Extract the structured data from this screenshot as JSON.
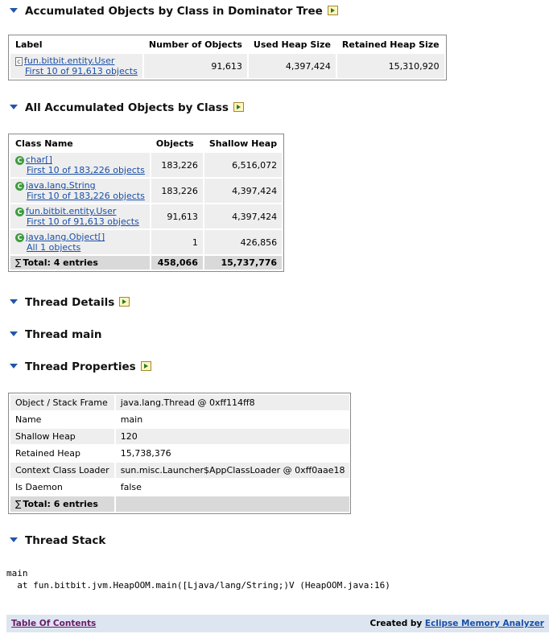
{
  "sections": {
    "accumulated_by_class_dominator": "Accumulated Objects by Class in Dominator Tree",
    "all_accumulated_by_class": "All Accumulated Objects by Class",
    "thread_details": "Thread Details",
    "thread_main": "Thread main",
    "thread_properties": "Thread Properties",
    "thread_stack": "Thread Stack"
  },
  "dominator_table": {
    "headers": [
      "Label",
      "Number of Objects",
      "Used Heap Size",
      "Retained Heap Size"
    ],
    "row": {
      "label": "fun.bitbit.entity.User",
      "sub": "First 10 of 91,613 objects",
      "number_of_objects": "91,613",
      "used_heap": "4,397,424",
      "retained_heap": "15,310,920"
    }
  },
  "class_table": {
    "headers": [
      "Class Name",
      "Objects",
      "Shallow Heap"
    ],
    "rows": [
      {
        "name": "char[]",
        "sub": "First 10 of 183,226 objects",
        "objects": "183,226",
        "shallow": "6,516,072"
      },
      {
        "name": "java.lang.String",
        "sub": "First 10 of 183,226 objects",
        "objects": "183,226",
        "shallow": "4,397,424"
      },
      {
        "name": "fun.bitbit.entity.User",
        "sub": "First 10 of 91,613 objects",
        "objects": "91,613",
        "shallow": "4,397,424"
      },
      {
        "name": "java.lang.Object[]",
        "sub": "All 1 objects",
        "objects": "1",
        "shallow": "426,856"
      }
    ],
    "total": {
      "label": "Total: 4 entries",
      "objects": "458,066",
      "shallow": "15,737,776"
    }
  },
  "properties_table": {
    "rows": [
      {
        "key": "Object / Stack Frame",
        "value": "java.lang.Thread @ 0xff114ff8"
      },
      {
        "key": "Name",
        "value": "main"
      },
      {
        "key": "Shallow Heap",
        "value": "120"
      },
      {
        "key": "Retained Heap",
        "value": "15,738,376"
      },
      {
        "key": "Context Class Loader",
        "value": "sun.misc.Launcher$AppClassLoader @ 0xff0aae18"
      },
      {
        "key": "Is Daemon",
        "value": "false"
      }
    ],
    "total": "Total: 6 entries"
  },
  "stack": {
    "line1": "main",
    "line2": "  at fun.bitbit.jvm.HeapOOM.main([Ljava/lang/String;)V (HeapOOM.java:16)"
  },
  "footer": {
    "toc": "Table Of Contents",
    "created_by": "Created by",
    "tool": "Eclipse Memory Analyzer"
  },
  "icons": {
    "section_toggle": "expand-triangle-icon",
    "opener": "open-in-new-icon",
    "class": "class-icon",
    "object": "object-instance-icon",
    "sum": "sigma-icon"
  },
  "colors": {
    "link": "#1a4fa8",
    "class_icon": "#3f9b3f",
    "footer_bg": "#dde6f0",
    "total_row": "#d9d9d9"
  }
}
